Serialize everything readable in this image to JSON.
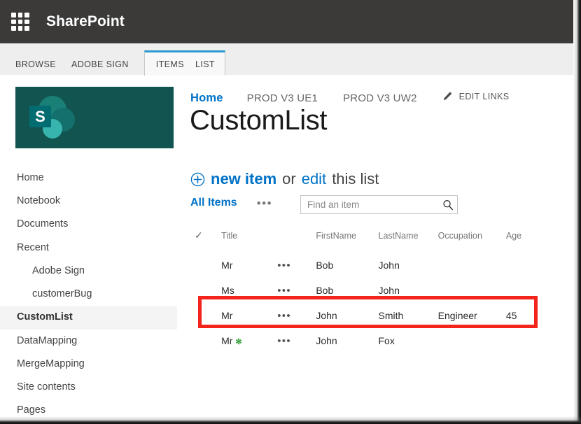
{
  "suite": {
    "waffle_icon": "app-launcher-waffle-icon",
    "title": "SharePoint"
  },
  "ribbon": {
    "tabs": [
      {
        "label": "BROWSE",
        "selected": false,
        "grouped": false
      },
      {
        "label": "ADOBE SIGN",
        "selected": false,
        "grouped": false
      },
      {
        "label": "ITEMS",
        "selected": true,
        "grouped": true
      },
      {
        "label": "LIST",
        "selected": false,
        "grouped": true
      }
    ]
  },
  "site_logo": {
    "letter": "S",
    "background": "#125450",
    "tile_color": "#036c70",
    "circle_dark": "#1a7f77",
    "circle_mid": "#13706c",
    "circle_light": "#37b4ae"
  },
  "top_nav": {
    "links": [
      {
        "label": "Home",
        "active": true
      },
      {
        "label": "PROD V3 UE1",
        "active": false
      },
      {
        "label": "PROD V3 UW2",
        "active": false
      }
    ],
    "edit_links": {
      "label": "EDIT LINKS",
      "icon": "pencil-icon"
    }
  },
  "page": {
    "title": "CustomList"
  },
  "new_item_line": {
    "plus_icon": "plus-circle-icon",
    "new_label": "new item",
    "or_label": "or",
    "edit_label": "edit",
    "tail_label": "this list"
  },
  "view_bar": {
    "view_name": "All Items",
    "ellipsis": "•••",
    "search": {
      "value": "",
      "placeholder": "Find an item",
      "icon": "search-icon"
    }
  },
  "sidebar": {
    "items": [
      {
        "label": "Home",
        "selected": false,
        "sub": false
      },
      {
        "label": "Notebook",
        "selected": false,
        "sub": false
      },
      {
        "label": "Documents",
        "selected": false,
        "sub": false
      },
      {
        "label": "Recent",
        "selected": false,
        "sub": false
      },
      {
        "label": "Adobe Sign",
        "selected": false,
        "sub": true
      },
      {
        "label": "customerBug",
        "selected": false,
        "sub": true
      },
      {
        "label": "CustomList",
        "selected": true,
        "sub": false
      },
      {
        "label": "DataMapping",
        "selected": false,
        "sub": false
      },
      {
        "label": "MergeMapping",
        "selected": false,
        "sub": false
      },
      {
        "label": "Site contents",
        "selected": false,
        "sub": false
      },
      {
        "label": "Pages",
        "selected": false,
        "sub": false
      }
    ]
  },
  "list": {
    "columns": [
      {
        "key": "check",
        "label": "✓",
        "is_icon": true
      },
      {
        "key": "title",
        "label": "Title"
      },
      {
        "key": "ellipsis",
        "label": ""
      },
      {
        "key": "firstname",
        "label": "FirstName"
      },
      {
        "key": "lastname",
        "label": "LastName"
      },
      {
        "key": "occupation",
        "label": "Occupation"
      },
      {
        "key": "age",
        "label": "Age"
      }
    ],
    "rows": [
      {
        "title": "Mr",
        "new_badge": "",
        "ellipsis": "•••",
        "firstname": "Bob",
        "lastname": "John",
        "occupation": "",
        "age": "",
        "highlighted": false
      },
      {
        "title": "Ms",
        "new_badge": "",
        "ellipsis": "•••",
        "firstname": "Bob",
        "lastname": "John",
        "occupation": "",
        "age": "",
        "highlighted": false
      },
      {
        "title": "Mr",
        "new_badge": "",
        "ellipsis": "•••",
        "firstname": "John",
        "lastname": "Smith",
        "occupation": "Engineer",
        "age": "45",
        "highlighted": true
      },
      {
        "title": "Mr",
        "new_badge": "✻",
        "ellipsis": "•••",
        "firstname": "John",
        "lastname": "Fox",
        "occupation": "",
        "age": "",
        "highlighted": false
      }
    ]
  },
  "annotation": {
    "highlight_color": "#f3241a",
    "target_row_index": 2
  },
  "colors": {
    "suite_bar": "#3b3a39",
    "ribbon": "#eeeeee",
    "accent_blue": "#0072c6",
    "tab_accent": "#2b9ad1",
    "new_badge_green": "#37a03e",
    "selected_nav": "#f4f4f4"
  }
}
